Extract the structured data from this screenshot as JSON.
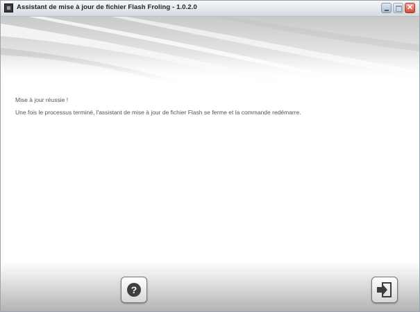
{
  "window": {
    "title": "Assistant de mise à jour de fichier Flash Froling - 1.0.2.0",
    "controls": {
      "minimize": "minimize-icon",
      "maximize": "maximize-icon",
      "close": "✕"
    }
  },
  "main": {
    "heading": "Mise à jour réussie !",
    "message": "Une fois le processus terminé, l'assistant de mise à jour de fichier Flash se ferme et la commande redémarre."
  },
  "footer": {
    "help_icon": "?",
    "exit_icon": "exit-icon"
  },
  "colors": {
    "background": "#ffffff",
    "text": "#555555",
    "title_bar": "#d6dbe1",
    "close_button": "#d44a37"
  }
}
